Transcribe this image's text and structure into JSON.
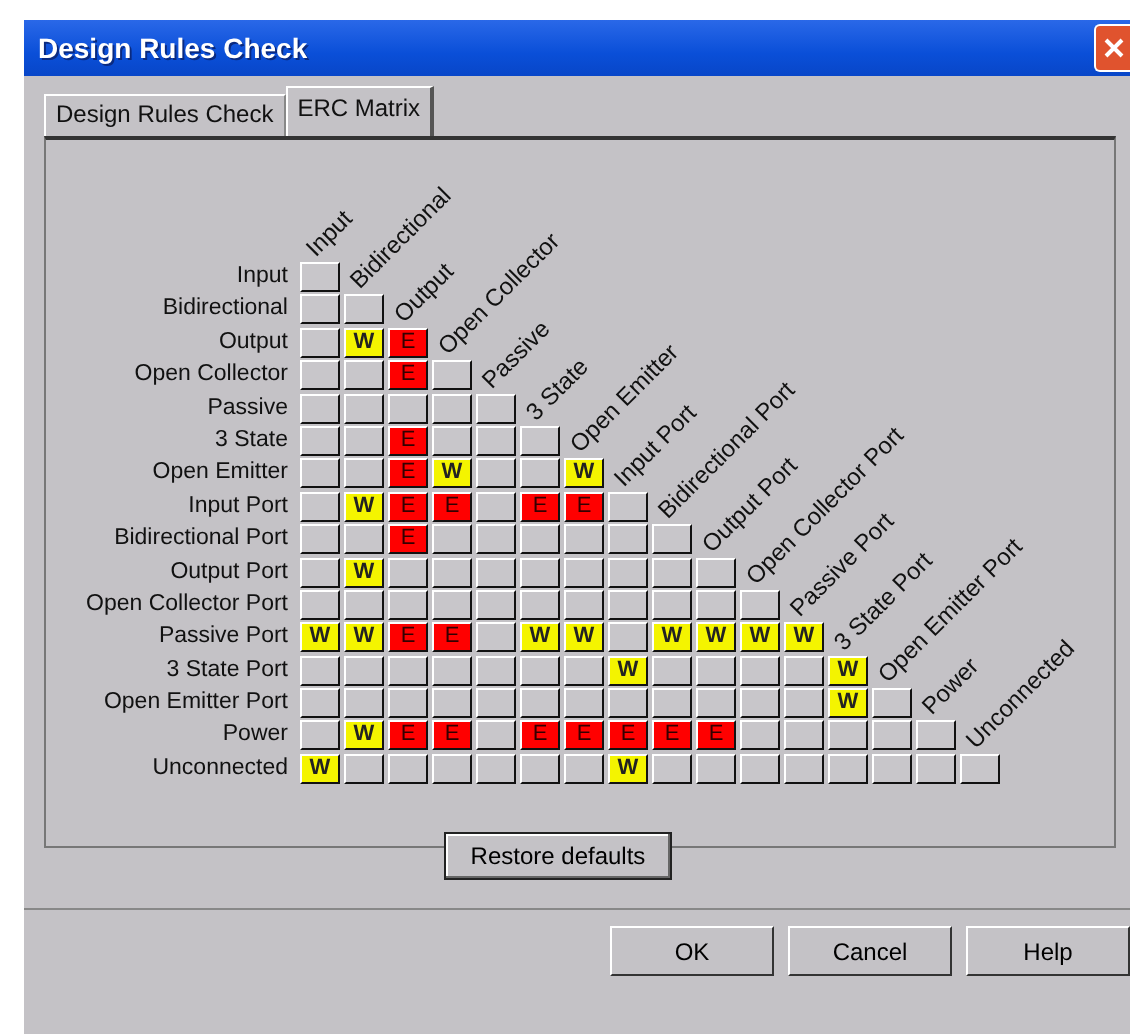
{
  "window": {
    "title": "Design Rules Check"
  },
  "tabs": [
    {
      "label": "Design Rules Check",
      "selected": false
    },
    {
      "label": "ERC Matrix",
      "selected": true
    }
  ],
  "matrix": {
    "rows": [
      {
        "label": "Input",
        "column_label": "Input",
        "cells": [
          {
            "kind": "none"
          }
        ]
      },
      {
        "label": "Bidirectional",
        "column_label": "Bidirectional",
        "cells": [
          {
            "kind": "none"
          },
          {
            "kind": "none"
          }
        ]
      },
      {
        "label": "Output",
        "column_label": "Output",
        "cells": [
          {
            "kind": "none"
          },
          {
            "kind": "warning",
            "text": "W"
          },
          {
            "kind": "error",
            "text": "E"
          }
        ]
      },
      {
        "label": "Open Collector",
        "column_label": "Open Collector",
        "cells": [
          {
            "kind": "none"
          },
          {
            "kind": "none"
          },
          {
            "kind": "error",
            "text": "E"
          },
          {
            "kind": "none"
          }
        ]
      },
      {
        "label": "Passive",
        "column_label": "Passive",
        "cells": [
          {
            "kind": "none"
          },
          {
            "kind": "none"
          },
          {
            "kind": "none"
          },
          {
            "kind": "none"
          },
          {
            "kind": "none"
          }
        ]
      },
      {
        "label": "3 State",
        "column_label": "3 State",
        "cells": [
          {
            "kind": "none"
          },
          {
            "kind": "none"
          },
          {
            "kind": "error",
            "text": "E"
          },
          {
            "kind": "none"
          },
          {
            "kind": "none"
          },
          {
            "kind": "none"
          }
        ]
      },
      {
        "label": "Open Emitter",
        "column_label": "Open Emitter",
        "cells": [
          {
            "kind": "none"
          },
          {
            "kind": "none"
          },
          {
            "kind": "error",
            "text": "E"
          },
          {
            "kind": "warning",
            "text": "W"
          },
          {
            "kind": "none"
          },
          {
            "kind": "none"
          },
          {
            "kind": "warning",
            "text": "W"
          }
        ]
      },
      {
        "label": "Input Port",
        "column_label": "Input Port",
        "cells": [
          {
            "kind": "none"
          },
          {
            "kind": "warning",
            "text": "W"
          },
          {
            "kind": "error",
            "text": "E"
          },
          {
            "kind": "error",
            "text": "E"
          },
          {
            "kind": "none"
          },
          {
            "kind": "error",
            "text": "E"
          },
          {
            "kind": "error",
            "text": "E"
          },
          {
            "kind": "none"
          }
        ]
      },
      {
        "label": "Bidirectional Port",
        "column_label": "Bidirectional Port",
        "cells": [
          {
            "kind": "none"
          },
          {
            "kind": "none"
          },
          {
            "kind": "error",
            "text": "E"
          },
          {
            "kind": "none"
          },
          {
            "kind": "none"
          },
          {
            "kind": "none"
          },
          {
            "kind": "none"
          },
          {
            "kind": "none"
          },
          {
            "kind": "none"
          }
        ]
      },
      {
        "label": "Output Port",
        "column_label": "Output Port",
        "cells": [
          {
            "kind": "none"
          },
          {
            "kind": "warning",
            "text": "W"
          },
          {
            "kind": "none"
          },
          {
            "kind": "none"
          },
          {
            "kind": "none"
          },
          {
            "kind": "none"
          },
          {
            "kind": "none"
          },
          {
            "kind": "none"
          },
          {
            "kind": "none"
          },
          {
            "kind": "none"
          }
        ]
      },
      {
        "label": "Open Collector Port",
        "column_label": "Open Collector Port",
        "cells": [
          {
            "kind": "none"
          },
          {
            "kind": "none"
          },
          {
            "kind": "none"
          },
          {
            "kind": "none"
          },
          {
            "kind": "none"
          },
          {
            "kind": "none"
          },
          {
            "kind": "none"
          },
          {
            "kind": "none"
          },
          {
            "kind": "none"
          },
          {
            "kind": "none"
          },
          {
            "kind": "none"
          }
        ]
      },
      {
        "label": "Passive Port",
        "column_label": "Passive Port",
        "cells": [
          {
            "kind": "warning",
            "text": "W"
          },
          {
            "kind": "warning",
            "text": "W"
          },
          {
            "kind": "error",
            "text": "E"
          },
          {
            "kind": "error",
            "text": "E"
          },
          {
            "kind": "none"
          },
          {
            "kind": "warning",
            "text": "W"
          },
          {
            "kind": "warning",
            "text": "W"
          },
          {
            "kind": "none"
          },
          {
            "kind": "warning",
            "text": "W"
          },
          {
            "kind": "warning",
            "text": "W"
          },
          {
            "kind": "warning",
            "text": "W"
          },
          {
            "kind": "warning",
            "text": "W"
          }
        ]
      },
      {
        "label": "3 State Port",
        "column_label": "3 State Port",
        "cells": [
          {
            "kind": "none"
          },
          {
            "kind": "none"
          },
          {
            "kind": "none"
          },
          {
            "kind": "none"
          },
          {
            "kind": "none"
          },
          {
            "kind": "none"
          },
          {
            "kind": "none"
          },
          {
            "kind": "warning",
            "text": "W"
          },
          {
            "kind": "none"
          },
          {
            "kind": "none"
          },
          {
            "kind": "none"
          },
          {
            "kind": "none"
          },
          {
            "kind": "warning",
            "text": "W"
          }
        ]
      },
      {
        "label": "Open Emitter Port",
        "column_label": "Open Emitter Port",
        "cells": [
          {
            "kind": "none"
          },
          {
            "kind": "none"
          },
          {
            "kind": "none"
          },
          {
            "kind": "none"
          },
          {
            "kind": "none"
          },
          {
            "kind": "none"
          },
          {
            "kind": "none"
          },
          {
            "kind": "none"
          },
          {
            "kind": "none"
          },
          {
            "kind": "none"
          },
          {
            "kind": "none"
          },
          {
            "kind": "none"
          },
          {
            "kind": "warning",
            "text": "W"
          },
          {
            "kind": "none"
          }
        ]
      },
      {
        "label": "Power",
        "column_label": "Power",
        "cells": [
          {
            "kind": "none"
          },
          {
            "kind": "warning",
            "text": "W"
          },
          {
            "kind": "error",
            "text": "E"
          },
          {
            "kind": "error",
            "text": "E"
          },
          {
            "kind": "none"
          },
          {
            "kind": "error",
            "text": "E"
          },
          {
            "kind": "error",
            "text": "E"
          },
          {
            "kind": "error",
            "text": "E"
          },
          {
            "kind": "error",
            "text": "E"
          },
          {
            "kind": "error",
            "text": "E"
          },
          {
            "kind": "none"
          },
          {
            "kind": "none"
          },
          {
            "kind": "none"
          },
          {
            "kind": "none"
          },
          {
            "kind": "none"
          }
        ]
      },
      {
        "label": "Unconnected",
        "column_label": "Unconnected",
        "cells": [
          {
            "kind": "warning",
            "text": "W"
          },
          {
            "kind": "none"
          },
          {
            "kind": "none"
          },
          {
            "kind": "none"
          },
          {
            "kind": "none"
          },
          {
            "kind": "none"
          },
          {
            "kind": "none"
          },
          {
            "kind": "warning",
            "text": "W"
          },
          {
            "kind": "none"
          },
          {
            "kind": "none"
          },
          {
            "kind": "none"
          },
          {
            "kind": "none"
          },
          {
            "kind": "none"
          },
          {
            "kind": "none"
          },
          {
            "kind": "none"
          },
          {
            "kind": "none"
          }
        ]
      }
    ]
  },
  "restore_button": "Restore defaults",
  "buttons": [
    "OK",
    "Cancel",
    "Help"
  ]
}
